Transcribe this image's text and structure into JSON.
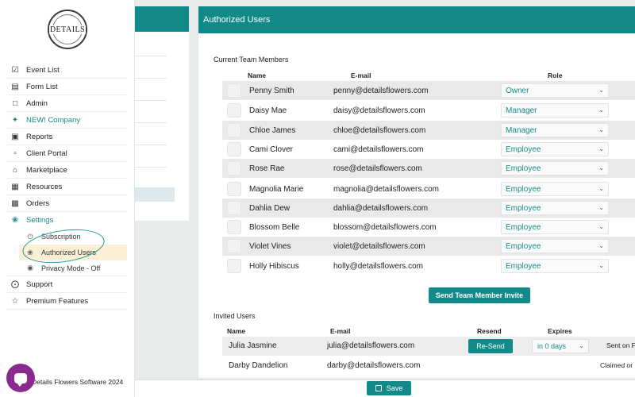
{
  "logo": {
    "text": "DETAILS"
  },
  "sidebar": {
    "items": [
      {
        "label": "Event List",
        "icon": "calendar-check-icon"
      },
      {
        "label": "Form List",
        "icon": "clipboard-icon"
      },
      {
        "label": "Admin",
        "icon": "lock-icon"
      },
      {
        "label": "NEW! Company",
        "icon": "sparkle-icon"
      },
      {
        "label": "Reports",
        "icon": "database-icon"
      },
      {
        "label": "Client Portal",
        "icon": "portal-icon"
      },
      {
        "label": "Marketplace",
        "icon": "store-icon"
      },
      {
        "label": "Resources",
        "icon": "image-icon"
      },
      {
        "label": "Orders",
        "icon": "orders-icon"
      },
      {
        "label": "Settings",
        "icon": "leaf-icon"
      }
    ],
    "sub_items": [
      {
        "label": "Subscription",
        "icon": "power-icon"
      },
      {
        "label": "Authorized Users",
        "icon": "leaf-icon"
      },
      {
        "label": "Privacy Mode - Off",
        "icon": "toggle-icon"
      }
    ],
    "bottom_items": [
      {
        "label": "Support",
        "icon": "lifebuoy-icon"
      },
      {
        "label": "Premium Features",
        "icon": "star-icon"
      }
    ],
    "footer": "Details Flowers Software 2024"
  },
  "main": {
    "title": "Authorized Users",
    "current_section": "Current Team Members",
    "headers": {
      "name": "Name",
      "email": "E-mail",
      "role": "Role"
    },
    "members": [
      {
        "name": "Penny Smith",
        "email": "penny@detailsflowers.com",
        "role": "Owner"
      },
      {
        "name": "Daisy Mae",
        "email": "daisy@detailsflowers.com",
        "role": "Manager"
      },
      {
        "name": "Chloe James",
        "email": "chloe@detailsflowers.com",
        "role": "Manager"
      },
      {
        "name": "Cami Clover",
        "email": "cami@detailsflowers.com",
        "role": "Employee"
      },
      {
        "name": "Rose Rae",
        "email": "rose@detailsflowers.com",
        "role": "Employee"
      },
      {
        "name": "Magnolia Marie",
        "email": "magnolia@detailsflowers.com",
        "role": "Employee"
      },
      {
        "name": "Dahlia Dew",
        "email": "dahlia@detailsflowers.com",
        "role": "Employee"
      },
      {
        "name": "Blossom Belle",
        "email": "blossom@detailsflowers.com",
        "role": "Employee"
      },
      {
        "name": "Violet Vines",
        "email": "violet@detailsflowers.com",
        "role": "Employee"
      },
      {
        "name": "Holly Hibiscus",
        "email": "holly@detailsflowers.com",
        "role": "Employee"
      }
    ],
    "invite_button": "Send Team Member Invite",
    "invited_section": "Invited Users",
    "invited_headers": {
      "name": "Name",
      "email": "E-mail",
      "resend": "Resend",
      "expires": "Expires"
    },
    "invited": [
      {
        "name": "Julia Jasmine",
        "email": "julia@detailsflowers.com",
        "resend": "Re-Send",
        "expires": "in 0 days",
        "status": "Sent on F"
      },
      {
        "name": "Darby Dandelion",
        "email": "darby@detailsflowers.com",
        "status": "Claimed or"
      }
    ]
  },
  "save_button": "Save",
  "colors": {
    "accent": "#138a8a",
    "chat": "#8a2a8f",
    "highlight": "#fbf0d6"
  }
}
